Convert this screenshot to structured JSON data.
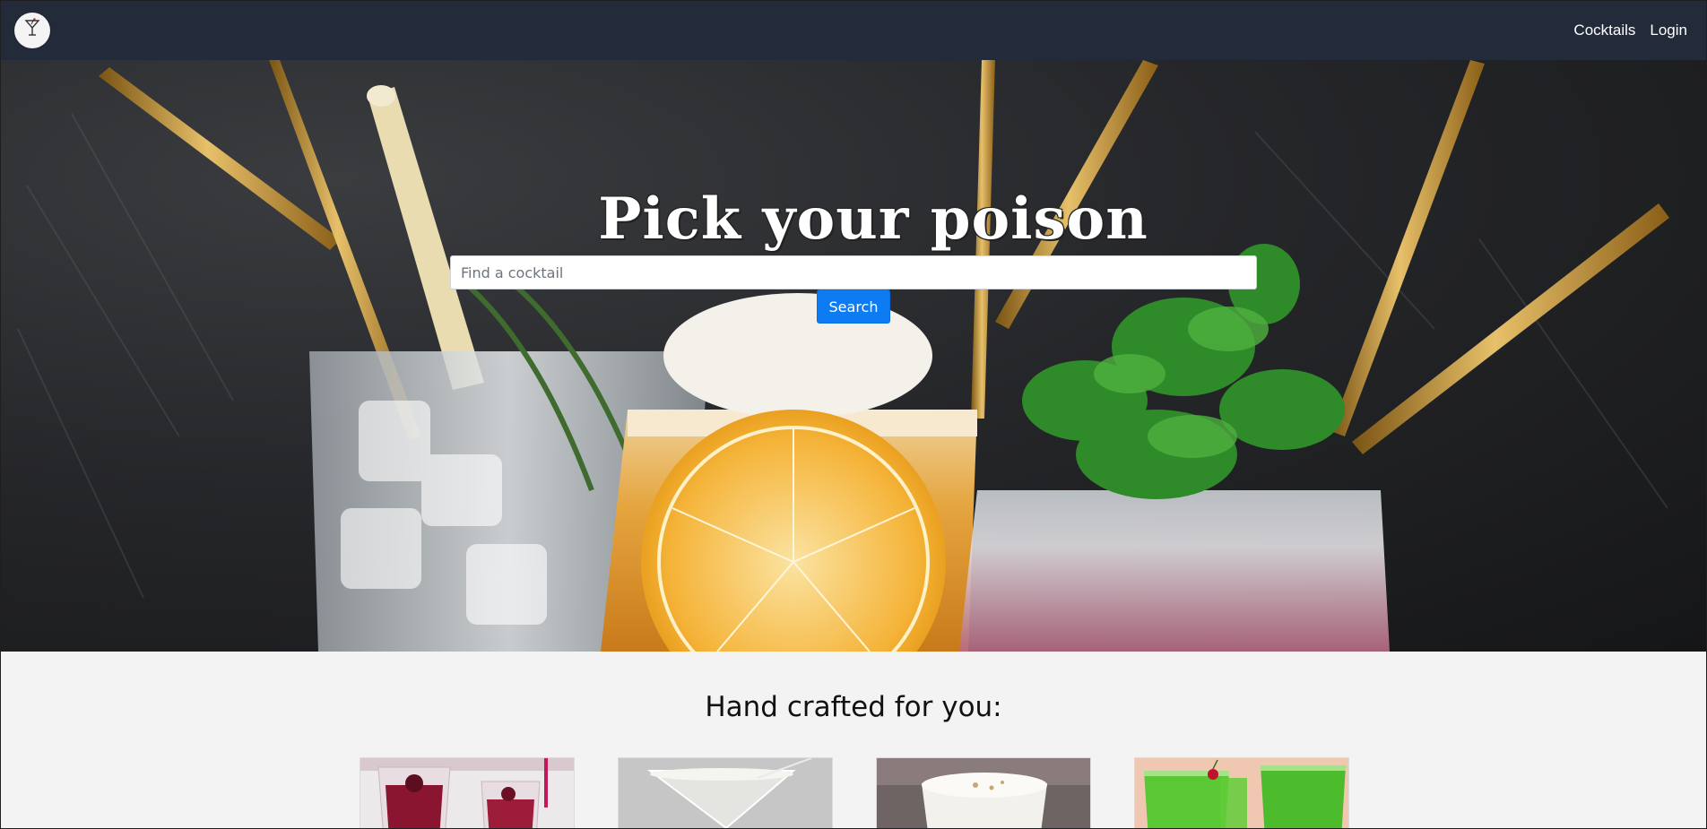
{
  "navbar": {
    "brand_icon": "cocktail-glass-icon",
    "links": [
      {
        "label": "Cocktails"
      },
      {
        "label": "Login"
      }
    ]
  },
  "hero": {
    "title": "Pick your poison",
    "search": {
      "placeholder": "Find a cocktail",
      "value": "",
      "button_label": "Search"
    }
  },
  "featured": {
    "heading": "Hand crafted for you:",
    "cards": [
      {
        "image": "red-berry-shots-image"
      },
      {
        "image": "martini-glass-image"
      },
      {
        "image": "white-sour-cocktail-image"
      },
      {
        "image": "green-cocktail-image"
      }
    ]
  },
  "colors": {
    "navbar": "#232a3a",
    "button": "#0d7cf2",
    "section_background": "#f3f3f3"
  }
}
